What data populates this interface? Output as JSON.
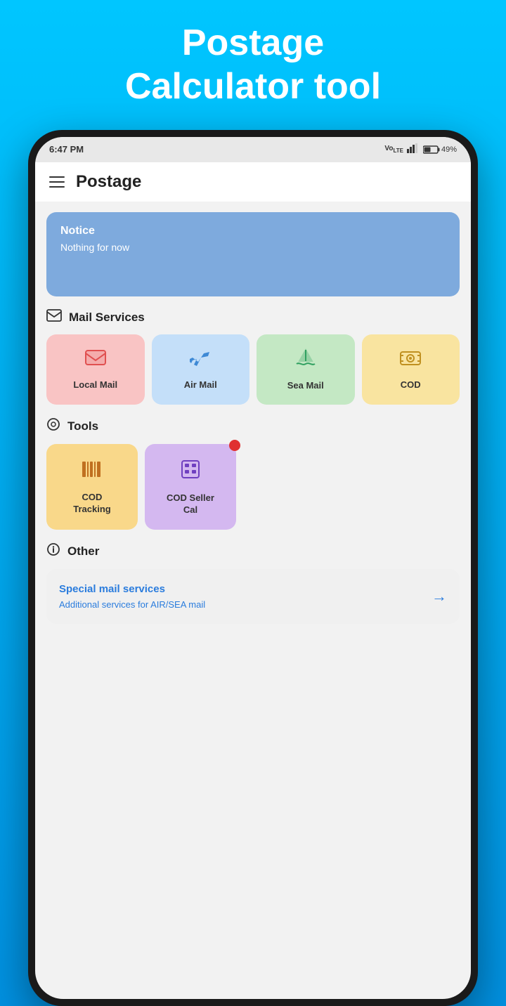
{
  "hero": {
    "title": "Postage\nCalculator tool"
  },
  "statusBar": {
    "time": "6:47 PM",
    "signal": "▐▌",
    "battery": "49%"
  },
  "topBar": {
    "title": "Postage"
  },
  "notice": {
    "title": "Notice",
    "body": "Nothing for now"
  },
  "mailServices": {
    "label": "Mail Services",
    "items": [
      {
        "id": "local-mail",
        "label": "Local Mail",
        "colorClass": "card-local",
        "iconClass": "tool-icon-local",
        "icon": "mail"
      },
      {
        "id": "air-mail",
        "label": "Air Mail",
        "colorClass": "card-air",
        "iconClass": "tool-icon-air",
        "icon": "plane"
      },
      {
        "id": "sea-mail",
        "label": "Sea Mail",
        "colorClass": "card-sea",
        "iconClass": "tool-icon-sea",
        "icon": "ship"
      },
      {
        "id": "cod",
        "label": "COD",
        "colorClass": "card-cod",
        "iconClass": "tool-icon-cod",
        "icon": "cash"
      }
    ]
  },
  "tools": {
    "label": "Tools",
    "items": [
      {
        "id": "cod-tracking",
        "label": "COD\nTracking",
        "colorClass": "card-cod-tracking",
        "iconClass": "tool-icon-tracking",
        "icon": "barcode"
      },
      {
        "id": "cod-seller",
        "label": "COD Seller\nCal",
        "colorClass": "card-cod-seller",
        "iconClass": "tool-icon-seller",
        "icon": "calc",
        "hasNotification": true
      }
    ]
  },
  "other": {
    "label": "Other",
    "card": {
      "title": "Special mail services",
      "subtitle": "Additional services for AIR/SEA mail"
    }
  }
}
